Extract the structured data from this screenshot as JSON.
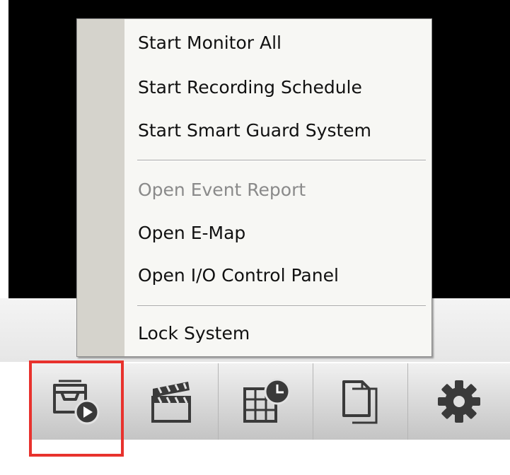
{
  "context_menu": {
    "items": [
      {
        "label": "Start Monitor All",
        "enabled": true
      },
      {
        "label": "Start Recording Schedule",
        "enabled": true
      },
      {
        "label": "Start Smart Guard System",
        "enabled": true
      },
      {
        "label": "Open Event Report",
        "enabled": false
      },
      {
        "label": "Open E-Map",
        "enabled": true
      },
      {
        "label": "Open I/O Control Panel",
        "enabled": true
      },
      {
        "label": "Lock System",
        "enabled": true
      }
    ]
  },
  "toolbar": {
    "buttons": [
      {
        "icon": "start-monitor-icon",
        "highlighted": true
      },
      {
        "icon": "clapperboard-icon",
        "highlighted": false
      },
      {
        "icon": "schedule-grid-clock-icon",
        "highlighted": false
      },
      {
        "icon": "documents-icon",
        "highlighted": false
      },
      {
        "icon": "gear-icon",
        "highlighted": false
      }
    ]
  },
  "colors": {
    "highlight": "#e8322d",
    "menu_background": "#f7f7f4",
    "menu_gutter": "#d5d3cc",
    "disabled_text": "#8a8a8a",
    "icon": "#3a3a3a"
  }
}
